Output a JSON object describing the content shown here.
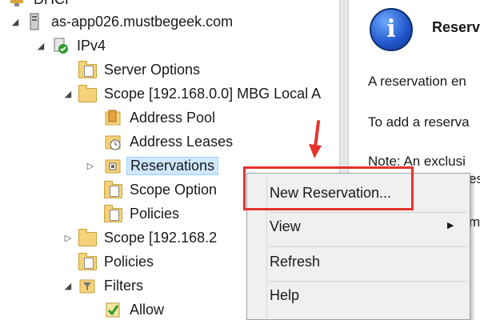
{
  "tree": {
    "root_label": "DHCP",
    "server": "as-app026.mustbegeek.com",
    "ipv4": "IPv4",
    "server_options": "Server Options",
    "scope1": "Scope [192.168.0.0] MBG Local A",
    "address_pool": "Address Pool",
    "address_leases": "Address Leases",
    "reservations": "Reservations",
    "scope_options": "Scope Option",
    "policies_scope": "Policies",
    "scope2": "Scope [192.168.2",
    "policies": "Policies",
    "filters": "Filters",
    "allow": "Allow"
  },
  "right_pane": {
    "title": "Reservations",
    "line1": "A reservation en",
    "line2": "To add a reserva",
    "line3": "Note: An exclusi",
    "line3b": "es",
    "line4": "m"
  },
  "context_menu": {
    "items": [
      "New Reservation...",
      "View",
      "Refresh",
      "Help"
    ],
    "submenu_arrow": "▶"
  },
  "colors": {
    "highlight": "#e5322d",
    "selection": "#cde8ff",
    "folder": "#f5d27a"
  }
}
